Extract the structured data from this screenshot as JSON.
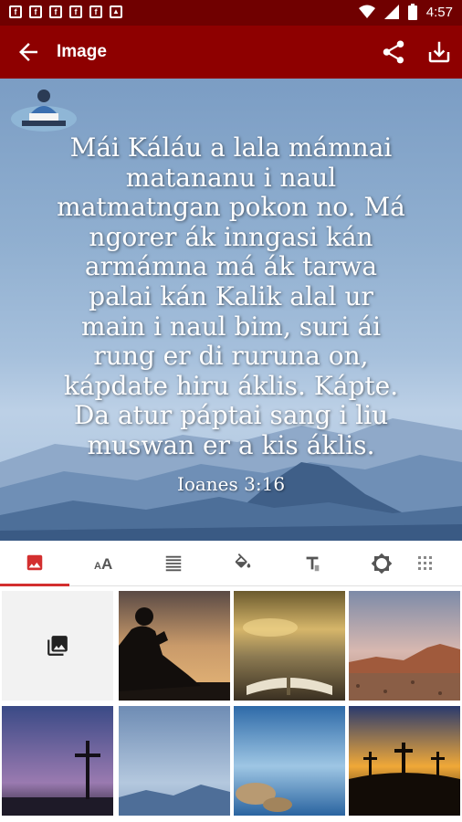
{
  "status_bar": {
    "time": "4:57",
    "notification_icons": [
      "facebook-icon",
      "facebook-icon",
      "facebook-icon",
      "facebook-icon",
      "facebook-icon",
      "image-icon"
    ],
    "system_icons": [
      "wifi-icon",
      "signal-icon",
      "battery-icon"
    ]
  },
  "app_bar": {
    "title": "Image",
    "actions": [
      "share-icon",
      "download-icon"
    ],
    "color": "#8e0000"
  },
  "hero": {
    "verse_lines": [
      "Mái Káláu a lala mámnai",
      "matananu i naul",
      "matmatngan pokon no. Má",
      "ngorer ák inngasi kán",
      "armámna má ák tarwa",
      "palai kán Kalik alal ur",
      "main i naul bim, suri ái",
      "rung er di ruruna on,",
      "kápdate hiru áklis. Kápte.",
      "Da atur páptai sang i liu",
      "muswan er a kis áklis."
    ],
    "reference": "Ioanes 3:16"
  },
  "tabs": [
    {
      "icon": "image-icon",
      "active": true
    },
    {
      "icon": "font-size-icon",
      "active": false
    },
    {
      "icon": "align-center-icon",
      "active": false
    },
    {
      "icon": "paint-bucket-icon",
      "active": false
    },
    {
      "icon": "text-style-icon",
      "active": false
    },
    {
      "icon": "brightness-icon",
      "active": false
    },
    {
      "icon": "texture-icon",
      "active": false
    }
  ],
  "accent_color": "#d32f2f",
  "gallery": [
    {
      "name": "open-gallery",
      "icon": "photo-library-icon"
    },
    {
      "name": "silhouette-reading-bible"
    },
    {
      "name": "open-bible-sunset"
    },
    {
      "name": "desert-mountains"
    },
    {
      "name": "cross-at-dusk"
    },
    {
      "name": "blue-mountains"
    },
    {
      "name": "rocky-lake"
    },
    {
      "name": "three-crosses-sunset"
    }
  ]
}
